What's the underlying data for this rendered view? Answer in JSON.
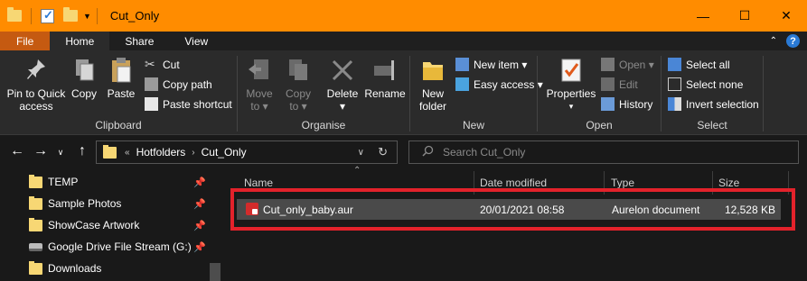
{
  "window": {
    "title": "Cut_Only",
    "minimize_glyph": "—",
    "maximize_glyph": "☐",
    "close_glyph": "✕"
  },
  "tabs": [
    {
      "label": "File"
    },
    {
      "label": "Home"
    },
    {
      "label": "Share"
    },
    {
      "label": "View"
    }
  ],
  "ribbon": {
    "clipboard": {
      "label": "Clipboard",
      "pin_line1": "Pin to Quick",
      "pin_line2": "access",
      "copy": "Copy",
      "paste": "Paste",
      "cut": "Cut",
      "copy_path": "Copy path",
      "paste_shortcut": "Paste shortcut"
    },
    "organise": {
      "label": "Organise",
      "move_line1": "Move",
      "move_line2": "to ▾",
      "copy_line1": "Copy",
      "copy_line2": "to ▾",
      "delete": "Delete ▾",
      "rename": "Rename"
    },
    "new": {
      "label": "New",
      "folder_line1": "New",
      "folder_line2": "folder",
      "new_item": "New item ▾",
      "easy_access": "Easy access ▾"
    },
    "open": {
      "label": "Open",
      "properties_line1": "Properties",
      "properties_line2": "▾",
      "open": "Open ▾",
      "edit": "Edit",
      "history": "History"
    },
    "select": {
      "label": "Select",
      "select_all": "Select all",
      "select_none": "Select none",
      "invert": "Invert selection"
    }
  },
  "address": {
    "overflow": "«",
    "crumbs": [
      "Hotfolders",
      "Cut_Only"
    ],
    "search_placeholder": "Search Cut_Only"
  },
  "nav_pane": {
    "items": [
      {
        "label": "TEMP",
        "pinned": true
      },
      {
        "label": "Sample Photos",
        "pinned": true
      },
      {
        "label": "ShowCase Artwork",
        "pinned": true
      },
      {
        "label": "Google Drive File Stream (G:)",
        "pinned": true
      },
      {
        "label": "Downloads",
        "pinned": false
      }
    ]
  },
  "file_list": {
    "columns": [
      "Name",
      "Date modified",
      "Type",
      "Size"
    ],
    "rows": [
      {
        "name": "Cut_only_baby.aur",
        "date": "20/01/2021 08:58",
        "type": "Aurelon document",
        "size": "12,528 KB"
      }
    ]
  },
  "colors": {
    "titlebar": "#ff8c00",
    "file_tab": "#c55a11",
    "highlight_box": "#e3222b"
  }
}
